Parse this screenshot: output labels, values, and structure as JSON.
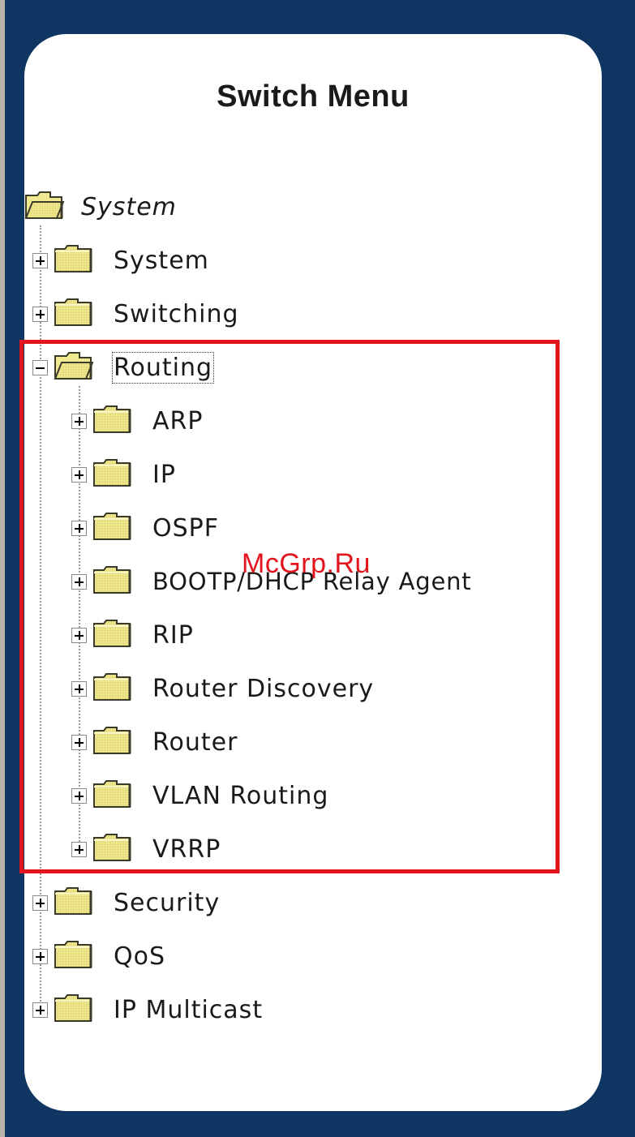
{
  "menu": {
    "title": "Switch Menu",
    "root_label": "System",
    "items": [
      {
        "label": "System",
        "expanded": false
      },
      {
        "label": "Switching",
        "expanded": false
      },
      {
        "label": "Routing",
        "expanded": true,
        "focused": true,
        "children": [
          {
            "label": "ARP"
          },
          {
            "label": "IP"
          },
          {
            "label": "OSPF"
          },
          {
            "label": "BOOTP/DHCP Relay Agent"
          },
          {
            "label": "RIP"
          },
          {
            "label": "Router Discovery"
          },
          {
            "label": "Router"
          },
          {
            "label": "VLAN Routing"
          },
          {
            "label": "VRRP"
          }
        ]
      },
      {
        "label": "Security",
        "expanded": false
      },
      {
        "label": "QoS",
        "expanded": false
      },
      {
        "label": "IP Multicast",
        "expanded": false
      }
    ]
  },
  "watermark": "McGrp.Ru",
  "colors": {
    "frame": "#0f3563",
    "panel": "#ffffff",
    "highlight": "#e2141c",
    "folder_fill": "#eee58a",
    "folder_outline": "#3a3a2a"
  },
  "icons": {
    "folder_closed": "folder-icon",
    "folder_open": "folder-open-icon",
    "expand": "plus-box-icon",
    "collapse": "minus-box-icon"
  }
}
